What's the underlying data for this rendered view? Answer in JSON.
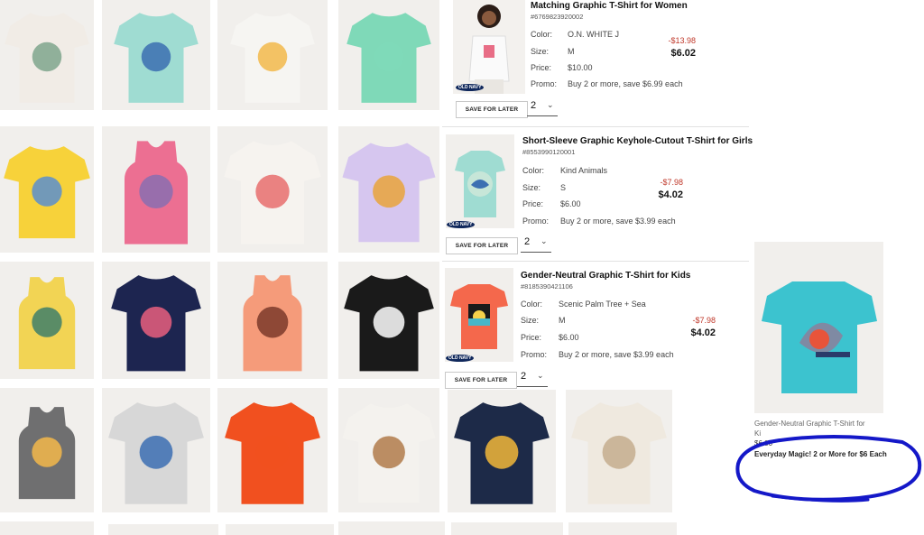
{
  "colors": {
    "accent_brand": "#10285c",
    "strike_price": "#c0392b",
    "annotation": "#1418c8"
  },
  "brand_badge": "OLD NAVY",
  "grid_products": [
    {
      "icon": "peace-garden-tee-icon",
      "shirt": "#f1ece6",
      "art": "#7fa68c"
    },
    {
      "icon": "kind-animals-tee-icon",
      "shirt": "#9fdcd2",
      "art": "#3b6fb2"
    },
    {
      "icon": "rainbow-logo-tee-icon",
      "shirt": "#f6f5f2",
      "art": "#f2b94b"
    },
    {
      "icon": "crossback-tee-icon",
      "shirt": "#7fd9b8",
      "art": "#7fd9b8"
    },
    {
      "icon": "butterfly-tee-icon",
      "shirt": "#f7d23a",
      "art": "#5a8fcf"
    },
    {
      "icon": "pink-tank-icon",
      "shirt": "#ec6f92",
      "art": "#8a6fb0"
    },
    {
      "icon": "usa-watermelon-tee-icon",
      "shirt": "#f6f3ef",
      "art": "#e86d6d"
    },
    {
      "icon": "lilac-mountain-tee-icon",
      "shirt": "#d6c6ef",
      "art": "#e9a33b"
    },
    {
      "icon": "recycle-tank-icon",
      "shirt": "#f2d454",
      "art": "#3f7f6a"
    },
    {
      "icon": "love-out-loud-navy-tee-icon",
      "shirt": "#1d2550",
      "art": "#e95f7e"
    },
    {
      "icon": "coral-tank-icon",
      "shirt": "#f59b7a",
      "art": "#7b3a2a"
    },
    {
      "icon": "love-out-loud-black-tee-icon",
      "shirt": "#1a1a1a",
      "art": "#ffffff"
    },
    {
      "icon": "stay-wild-tank-icon",
      "shirt": "#6f6f70",
      "art": "#f4b84a"
    },
    {
      "icon": "grey-logo-tee-icon",
      "shirt": "#d7d7d7",
      "art": "#3c6fb3"
    },
    {
      "icon": "red-crossback-tee-icon",
      "shirt": "#f1501f",
      "art": "#f1501f"
    },
    {
      "icon": "road-photo-tee-icon",
      "shirt": "#f4f2ee",
      "art": "#b07b4a"
    },
    {
      "icon": "happy-dance-tee-icon",
      "shirt": "#1d2a48",
      "art": "#f2b73a"
    },
    {
      "icon": "stripe-tee-icon",
      "shirt": "#efe9df",
      "art": "#c4ad8e"
    }
  ],
  "cart": {
    "labels": {
      "color": "Color:",
      "size": "Size:",
      "price": "Price:",
      "promo": "Promo:"
    },
    "save_label": "SAVE FOR LATER",
    "items": [
      {
        "title": "Matching Graphic T-Shirt for Women",
        "sku": "#6769823920002",
        "color": "O.N. WHITE J",
        "size": "M",
        "price": "$10.00",
        "promo": "Buy 2 or more, save $6.99 each",
        "discount": "-$13.98",
        "total": "$6.02",
        "qty": "2",
        "icon": "women-graphic-tee-photo"
      },
      {
        "title": "Short-Sleeve Graphic Keyhole-Cutout T-Shirt for Girls",
        "sku": "#8553990120001",
        "color": "Kind Animals",
        "size": "S",
        "price": "$6.00",
        "promo": "Buy 2 or more, save $3.99 each",
        "discount": "-$7.98",
        "total": "$4.02",
        "qty": "2",
        "icon": "kind-animals-tee-photo"
      },
      {
        "title": "Gender-Neutral Graphic T-Shirt for Kids",
        "sku": "#8185390421106",
        "color": "Scenic Palm Tree + Sea",
        "size": "M",
        "price": "$6.00",
        "promo": "Buy 2 or more, save $3.99 each",
        "discount": "-$7.98",
        "total": "$4.02",
        "qty": "2",
        "icon": "palm-tree-tee-photo"
      }
    ]
  },
  "recommendation": {
    "name_line1": "Gender-Neutral Graphic T-Shirt for",
    "name_line2": "Ki",
    "price": "$6.00",
    "promo": "Everyday Magic! 2 or More for $6 Each",
    "icon": "shark-guitar-tee-photo"
  },
  "annotation_icon": "hand-drawn-blue-circle"
}
